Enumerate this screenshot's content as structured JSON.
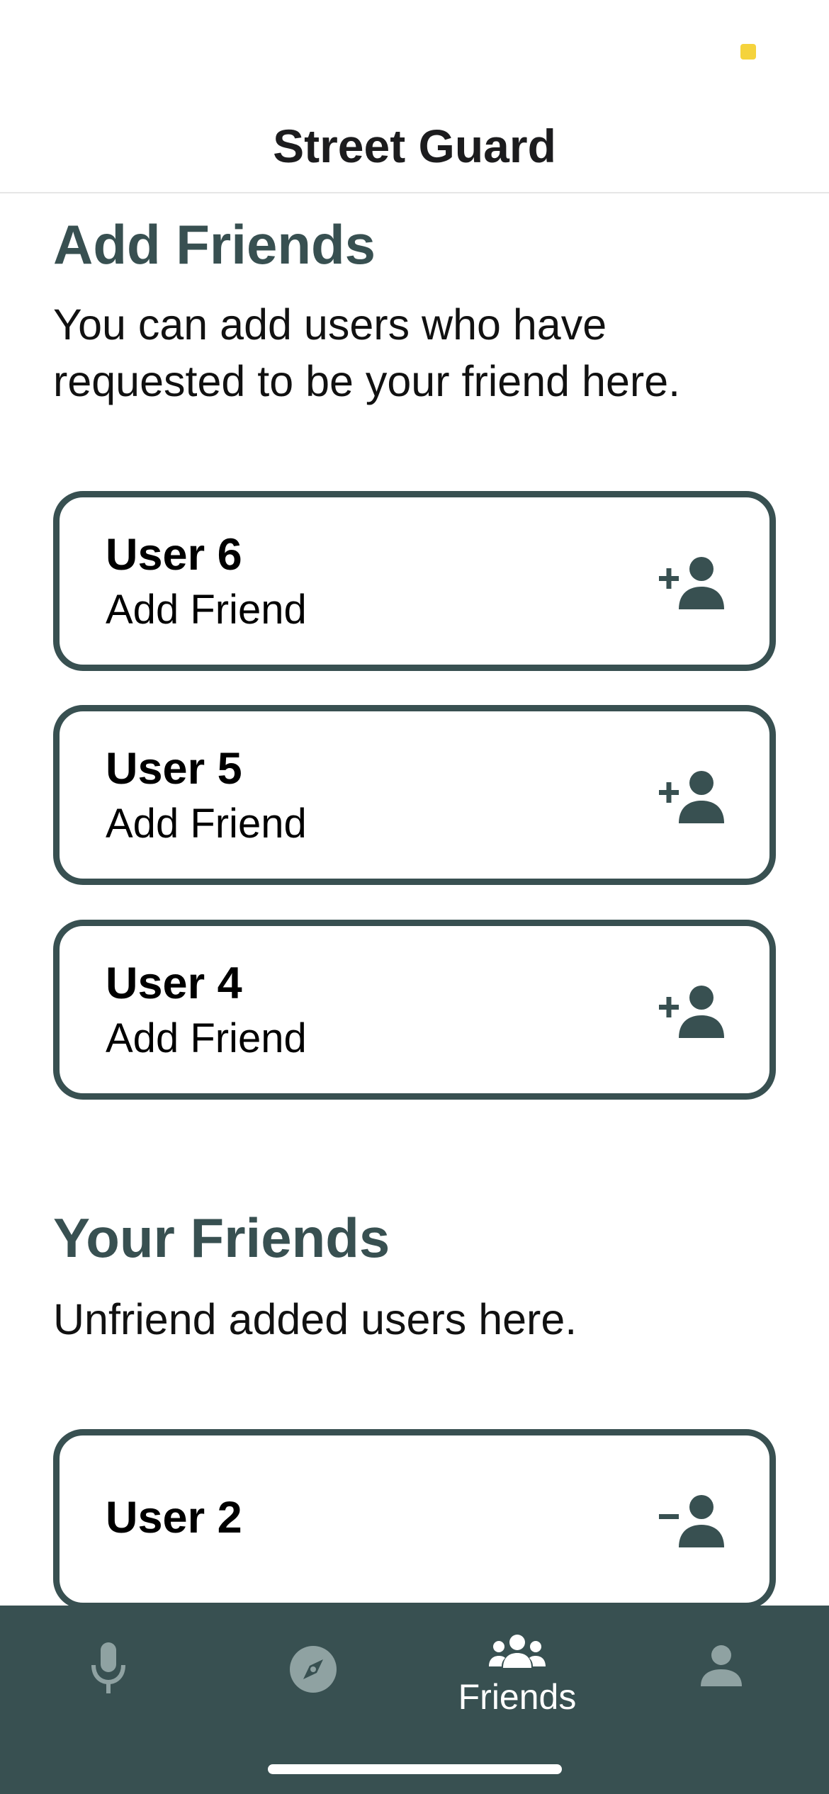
{
  "header": {
    "title": "Street Guard"
  },
  "add_section": {
    "title": "Add Friends",
    "description": "You can add users who have requested to be your friend here.",
    "requests": [
      {
        "name": "User 6",
        "action": "Add Friend",
        "icon": "person-add-icon"
      },
      {
        "name": "User 5",
        "action": "Add Friend",
        "icon": "person-add-icon"
      },
      {
        "name": "User 4",
        "action": "Add Friend",
        "icon": "person-add-icon"
      }
    ]
  },
  "friends_section": {
    "title": "Your Friends",
    "description": "Unfriend added users here.",
    "friends": [
      {
        "name": "User 2",
        "icon": "person-remove-icon"
      }
    ]
  },
  "tabbar": {
    "tabs": [
      {
        "icon": "microphone-icon",
        "label": "",
        "active": false
      },
      {
        "icon": "compass-icon",
        "label": "",
        "active": false
      },
      {
        "icon": "friends-icon",
        "label": "Friends",
        "active": true
      },
      {
        "icon": "profile-icon",
        "label": "",
        "active": false
      }
    ]
  },
  "colors": {
    "accent": "#385051",
    "status_dot": "#f5d33c",
    "inactive_tab": "#8fa2a2"
  }
}
